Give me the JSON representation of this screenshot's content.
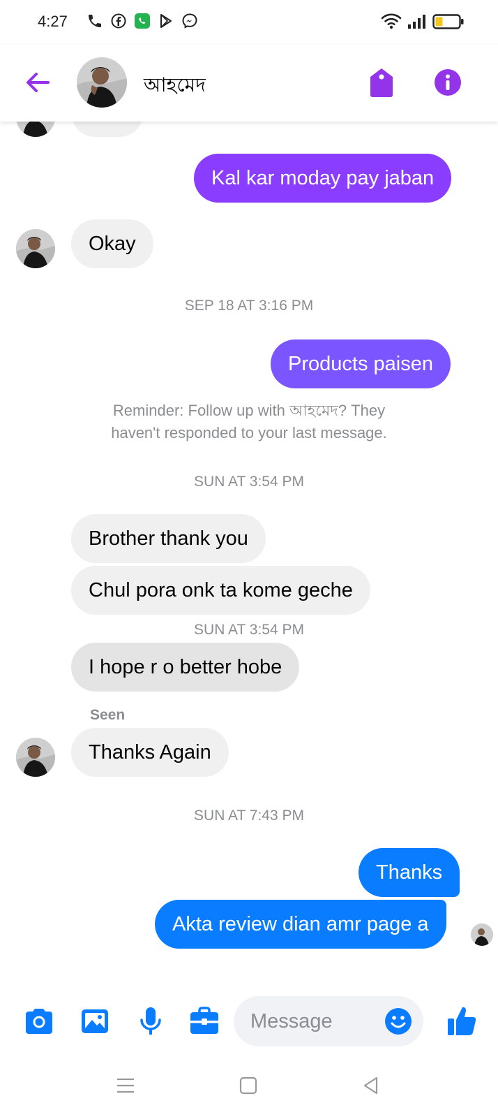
{
  "status": {
    "time": "4:27"
  },
  "header": {
    "contact_name": "আহমেদ"
  },
  "colors": {
    "accent": "#9333ea",
    "out_purple": "#8b3dff",
    "out_violet": "#7b55ff",
    "out_blue": "#0a7cff",
    "bubble_in": "#f0f0f0",
    "icon_blue": "#0a7cff"
  },
  "messages": {
    "out_1": "Kal kar moday pay jaban",
    "in_okay": "Okay",
    "ts_1": "SEP 18 AT 3:16 PM",
    "out_2": "Products paisen",
    "reminder_line1": "Reminder: Follow up with আহমেদ? They",
    "reminder_line2": "haven't responded to your last message.",
    "ts_2": "SUN AT 3:54 PM",
    "in_1": "Brother thank you",
    "in_2": "Chul pora onk ta kome geche",
    "ts_3": "SUN AT 3:54 PM",
    "in_3": "I hope r o better hobe",
    "seen": "Seen",
    "in_4": "Thanks Again",
    "ts_4": "SUN AT 7:43 PM",
    "out_3": "Thanks",
    "out_4": "Akta review dian amr page a"
  },
  "composer": {
    "placeholder": "Message"
  }
}
